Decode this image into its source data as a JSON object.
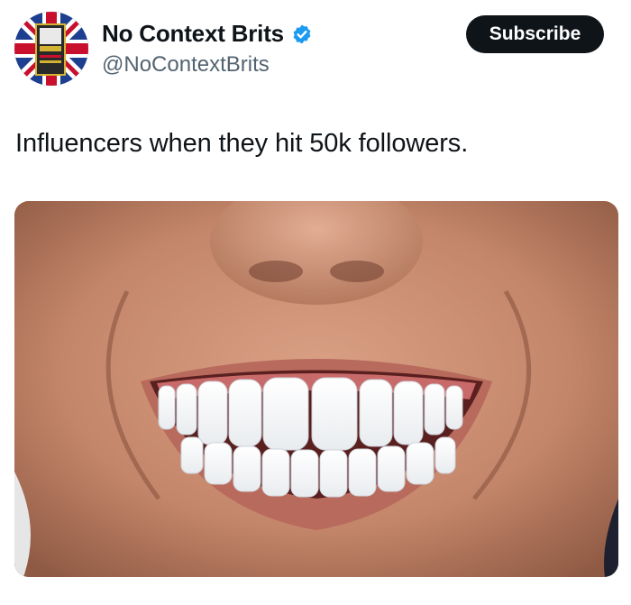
{
  "author": {
    "display_name": "No Context Brits",
    "handle": "@NoContextBrits",
    "verified_icon": "verified-badge-icon",
    "avatar_icon": "union-jack-book-avatar",
    "avatar_text": "EVERYTHING GREAT"
  },
  "actions": {
    "subscribe_label": "Subscribe"
  },
  "tweet": {
    "text": "Influencers when they hit 50k followers."
  },
  "media": {
    "description_icon": "smiling-mouth-photo"
  },
  "colors": {
    "text_primary": "#0f1419",
    "text_secondary": "#536471",
    "verified_blue": "#1d9bf0",
    "subscribe_bg": "#0f1419"
  }
}
